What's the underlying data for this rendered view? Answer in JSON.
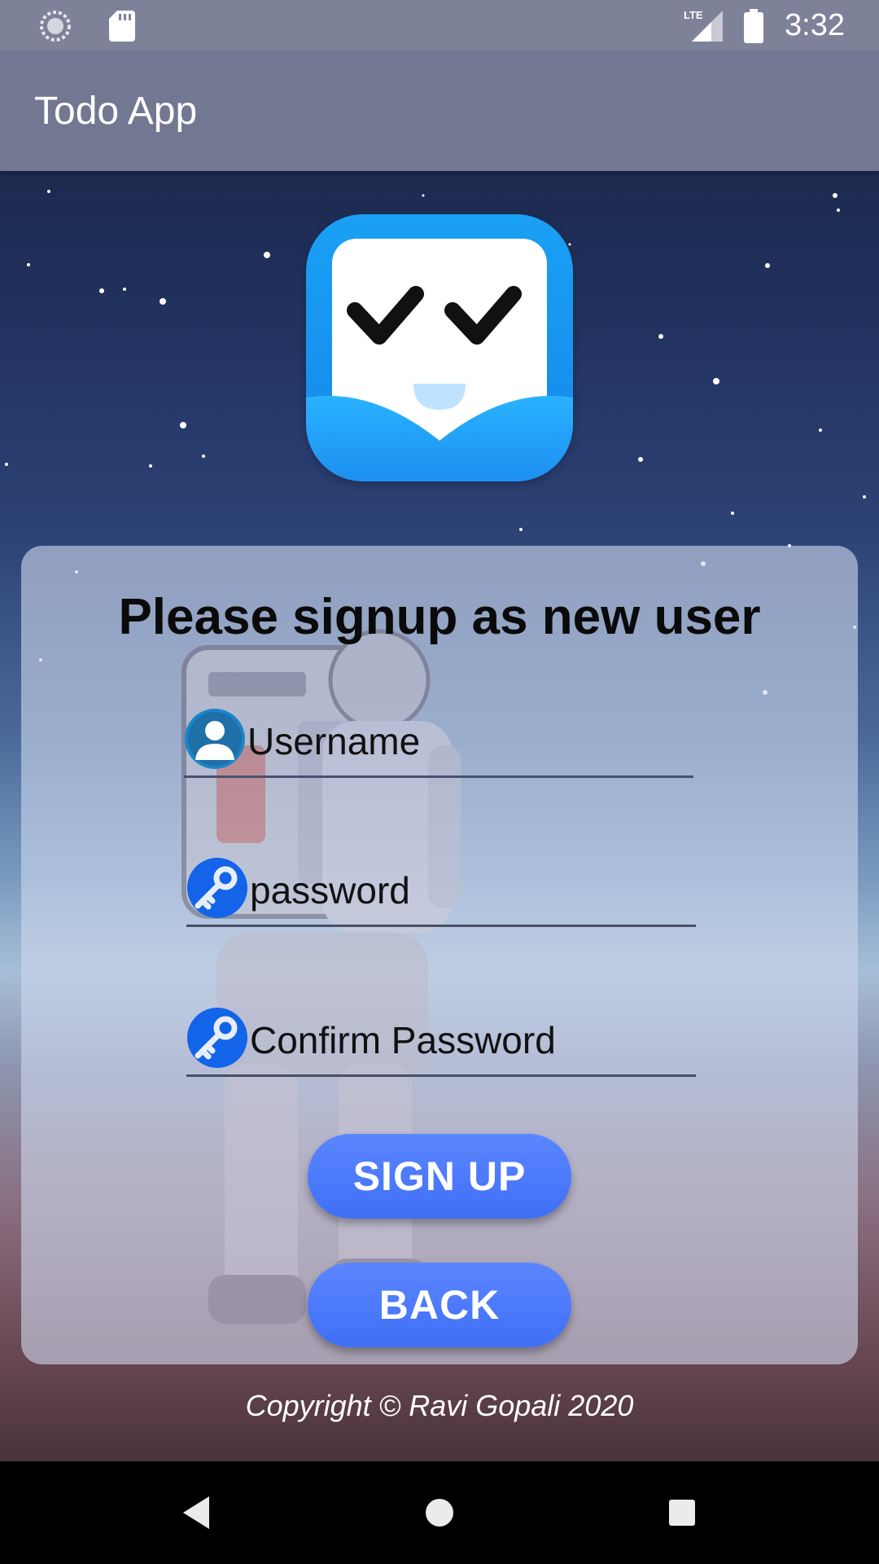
{
  "status_bar": {
    "time": "3:32",
    "network_label": "LTE",
    "icons": [
      "sync-icon",
      "sd-card-icon",
      "lte-signal-icon",
      "battery-icon"
    ]
  },
  "app_bar": {
    "title": "Todo App"
  },
  "logo": {
    "icon": "todo-logo-icon"
  },
  "signup_card": {
    "title": "Please signup as new user",
    "username": {
      "placeholder": "Username",
      "icon": "user-icon"
    },
    "password": {
      "placeholder": "password",
      "icon": "key-icon"
    },
    "confirm_password": {
      "placeholder": "Confirm Password",
      "icon": "key-icon"
    },
    "signup_button": "SIGN UP",
    "back_button": "BACK"
  },
  "footer": {
    "copyright": "Copyright © Ravi Gopali 2020"
  },
  "nav_bar": {
    "icons": [
      "back-triangle-icon",
      "home-circle-icon",
      "recents-square-icon"
    ]
  },
  "colors": {
    "status_bar": "#7e8299",
    "app_bar": "#727792",
    "button": "#4f7cff",
    "logo": "#1a9bf3"
  }
}
